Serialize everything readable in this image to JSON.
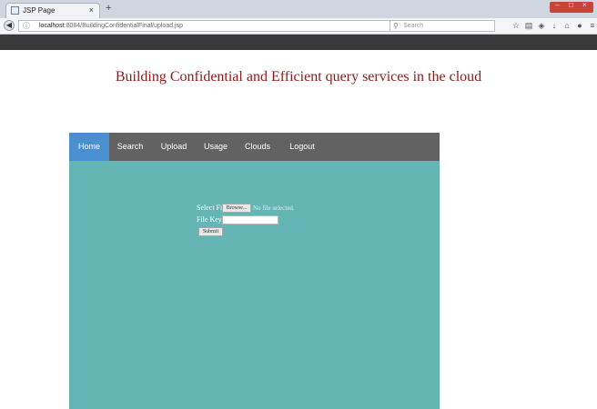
{
  "browser": {
    "tab_title": "JSP Page",
    "tab_close": "×",
    "new_tab": "+",
    "url_host": "localhost",
    "url_path": ":8084/BuildingConfidentialFinal/upload.jsp",
    "search_placeholder": "Search",
    "window_controls": [
      "–",
      "□",
      "×"
    ],
    "toolbar_icons": [
      "star-icon",
      "clipboard-icon",
      "shield-icon",
      "download-icon",
      "home-icon",
      "chat-icon",
      "menu-icon"
    ]
  },
  "page": {
    "heading": "Building Confidential and Efficient query services in the cloud"
  },
  "menu": {
    "items": [
      {
        "label": "Home",
        "active": true
      },
      {
        "label": "Search",
        "active": false
      },
      {
        "label": "Upload",
        "active": false
      },
      {
        "label": "Usage",
        "active": false
      },
      {
        "label": "Clouds",
        "active": false
      },
      {
        "label": "Logout",
        "active": false
      }
    ]
  },
  "form": {
    "select_file_label": "Select File",
    "browse_label": "Browse...",
    "no_file_text": "No file selected.",
    "file_key_label": "File Key",
    "file_key_value": "",
    "submit_label": "Submit"
  },
  "colors": {
    "heading": "#8b1a1a",
    "panel": "#65b5b5",
    "menubar": "#626262",
    "menu_active": "#4a8fd0",
    "top_strip": "#3a3a3a"
  }
}
